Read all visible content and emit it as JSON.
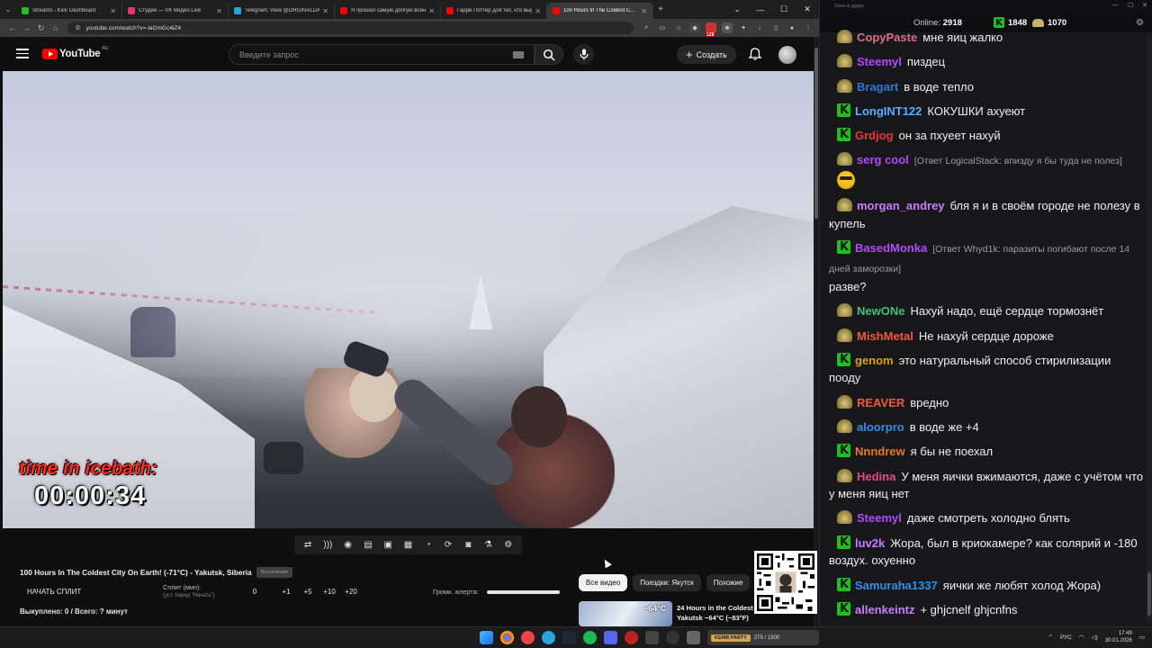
{
  "browser": {
    "tabs": [
      {
        "title": "Streams - Kick Dashboard",
        "color": "#20c020",
        "active": false
      },
      {
        "title": "Студия — VK Видео Live",
        "color": "#e8336d",
        "active": false
      },
      {
        "title": "Telegram: View @ORGINALDA...",
        "color": "#2aa3e0",
        "active": false
      },
      {
        "title": "Я прошел самую долгую войну...",
        "color": "#ff0000",
        "active": false
      },
      {
        "title": "Гарри Поттер для тех, кто выр...",
        "color": "#ff0000",
        "active": false
      },
      {
        "title": "100 Hours In The Coldest C...",
        "color": "#ff0000",
        "active": true
      }
    ],
    "url": "youtube.com/watch?v=-laGmGc4iZ4",
    "ext_badge": "128"
  },
  "youtube": {
    "logo_text": "YouTube",
    "region": "RU",
    "search_placeholder": "Введите запрос",
    "create_label": "Создать"
  },
  "video": {
    "overlay_label": "time in icebath:",
    "overlay_time": "00:00:34",
    "title": "100 Hours In The Coldest City On Earth! (-71°C) - Yakutsk, Siberia",
    "badge": "Вступление"
  },
  "split": {
    "start_label": "НАЧАТЬ СПЛИТ",
    "minutes_label": "Сплит (мин):",
    "minutes_sub": "(уст. перед \"Начать\")",
    "value": "0",
    "increments": [
      "+1",
      "+5",
      "+10",
      "+20"
    ],
    "volume_label": "Громк. алерта:",
    "volume_level": 1.0,
    "bought_text": "Выкуплено: 0 / Всего: ? минут"
  },
  "chips": [
    "Все видео",
    "Поездки: Якутск",
    "Похожие"
  ],
  "recommendation": {
    "thumb_temp": "−64°C",
    "title": "24 Hours in the Coldest City on Earth Yakutsk −64°C (−83°F)"
  },
  "chat": {
    "window_title": "Окно в дурку",
    "online_label": "Online:",
    "online_count": "2918",
    "kick_count": "1848",
    "other_count": "1070",
    "messages": [
      {
        "user": "CopyPaste",
        "color": "#d96f8c",
        "avatar": "c",
        "text": "мне яиц жалко",
        "reply": ""
      },
      {
        "user": "Steemyl",
        "color": "#b447ff",
        "avatar": "c",
        "text": "пиздец",
        "reply": ""
      },
      {
        "user": "Bragart",
        "color": "#2e78d6",
        "avatar": "c",
        "text": "в воде тепло",
        "reply": ""
      },
      {
        "user": "LongINT122",
        "color": "#5ab0ff",
        "avatar": "k",
        "text": "КОКУШКИ ахуеют",
        "reply": ""
      },
      {
        "user": "Grdjog",
        "color": "#e8363d",
        "avatar": "k",
        "text": "он за пхуеет нахуй",
        "reply": ""
      },
      {
        "user": "serg cool",
        "color": "#b447ff",
        "avatar": "c",
        "text": "",
        "reply": "[Ответ LogicalStack: впизду я бы туда не полез]"
      },
      {
        "user": "morgan_andrey",
        "color": "#c77dff",
        "avatar": "c",
        "text": "бля я и в своём городе не полезу в купель",
        "reply": ""
      },
      {
        "user": "BasedMonka",
        "color": "#b447ff",
        "avatar": "k",
        "text": "разве?",
        "reply": "[Ответ Whyd1k: паразиты погибают после 14 дней заморозки]"
      },
      {
        "user": "NewONe",
        "color": "#3ec27a",
        "avatar": "c",
        "text": "Нахуй надо, ещё сердце тормознёт",
        "reply": ""
      },
      {
        "user": "MishMetal",
        "color": "#ef5a3c",
        "avatar": "c",
        "text": "Не нахуй сердце дороже",
        "reply": ""
      },
      {
        "user": "genom",
        "color": "#d9a400",
        "avatar": "k",
        "text": "это натуральный способ стирилизации пооду",
        "reply": ""
      },
      {
        "user": "REAVER",
        "color": "#ef5a3c",
        "avatar": "c",
        "text": "вредно",
        "reply": ""
      },
      {
        "user": "aloorpro",
        "color": "#2f8ff0",
        "avatar": "c",
        "text": "в воде же +4",
        "reply": ""
      },
      {
        "user": "Nnndrew",
        "color": "#e87a2e",
        "avatar": "k",
        "text": "я бы не поехал",
        "reply": ""
      },
      {
        "user": "Hedina",
        "color": "#e04c8a",
        "avatar": "c",
        "text": "У меня яички вжимаются, даже с учётом что у меня яиц нет",
        "reply": ""
      },
      {
        "user": "Steemyl",
        "color": "#b447ff",
        "avatar": "c",
        "text": "даже смотреть холодно блять",
        "reply": ""
      },
      {
        "user": "luv2k",
        "color": "#c77dff",
        "avatar": "k",
        "text": "Жора, был в криокамере? как солярий и -180 воздух. охуенно",
        "reply": ""
      },
      {
        "user": "Samuraha1337",
        "color": "#2f8ff0",
        "avatar": "k",
        "text": "яички же любят холод Жора)",
        "reply": ""
      },
      {
        "user": "allenkeintz",
        "color": "#c77dff",
        "avatar": "k",
        "text": "+ ghjcnelf ghjcnfns",
        "reply": ""
      }
    ]
  },
  "taskbar": {
    "kick_badge": "KEMB PARTY",
    "kick_progress": "275 / 1500",
    "lang": "РУС",
    "time": "17:49",
    "date": "30.01.2026"
  }
}
